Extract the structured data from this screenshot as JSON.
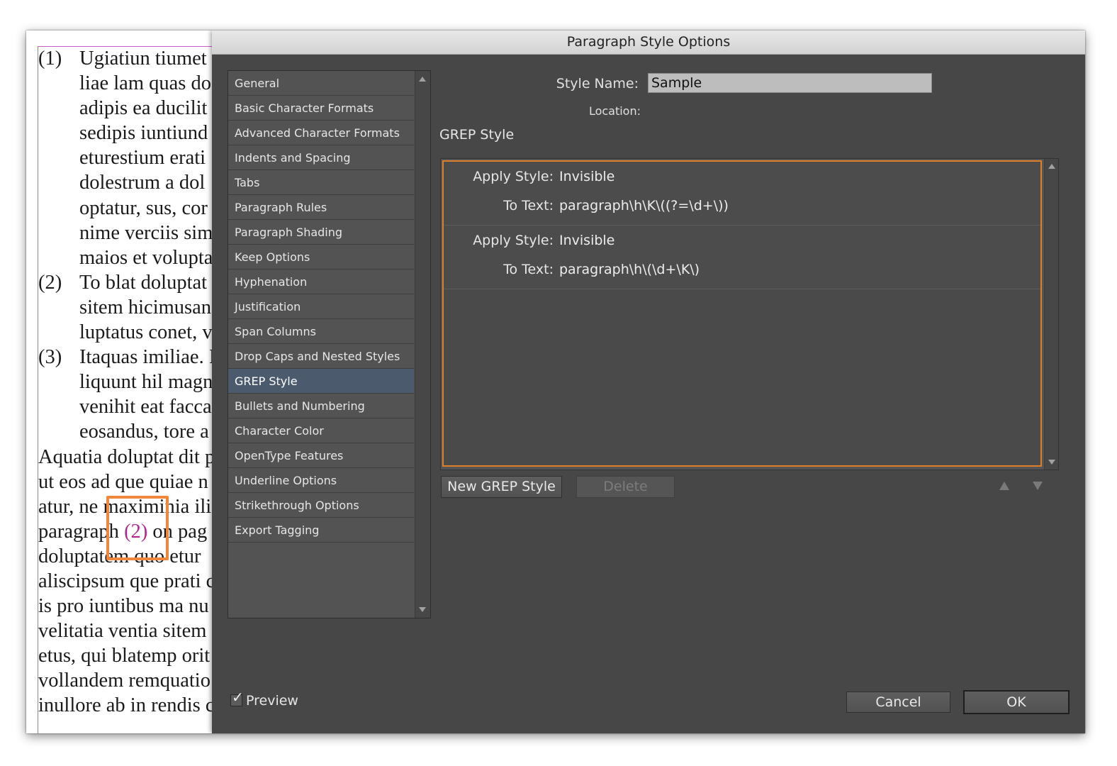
{
  "document": {
    "lines": [
      {
        "num": "(1)",
        "text": "Ugiatiun tiumet"
      },
      {
        "num": "",
        "text": "liae lam quas do"
      },
      {
        "num": "",
        "text": "adipis ea ducilit"
      },
      {
        "num": "",
        "text": "sedipis iuntiund"
      },
      {
        "num": "",
        "text": "eturestium erati"
      },
      {
        "num": "",
        "text": "dolestrum a dol"
      },
      {
        "num": "",
        "text": "optatur, sus, cor"
      },
      {
        "num": "",
        "text": "nime verciis sim"
      },
      {
        "num": "",
        "text": "maios et volupta"
      },
      {
        "num": "(2)",
        "text": "To blat doluptat"
      },
      {
        "num": "",
        "text": "sitem hicimusan"
      },
      {
        "num": "",
        "text": "luptatus conet, v"
      },
      {
        "num": "(3)",
        "text": "Itaquas imiliae. I"
      },
      {
        "num": "",
        "text": "liquunt hil magn"
      },
      {
        "num": "",
        "text": "venihit eat facca"
      },
      {
        "num": "",
        "text": "eosandus, tore a"
      }
    ],
    "body_lines": [
      "Aquatia doluptat dit p",
      "ut eos ad que quiae n",
      "atur, ne maximinia ili",
      "doluptatem quo etur",
      "aliscipsum que prati c",
      "is pro iuntibus ma nu",
      "velitatia ventia sitem",
      "etus, qui blatemp orit",
      "vollandem remquatio",
      "inullore ab in rendis c"
    ],
    "ref_line": {
      "before": "paragraph ",
      "ref": "(2)",
      "after": " on pag"
    }
  },
  "dialog": {
    "title": "Paragraph Style Options",
    "categories": [
      "General",
      "Basic Character Formats",
      "Advanced Character Formats",
      "Indents and Spacing",
      "Tabs",
      "Paragraph Rules",
      "Paragraph Shading",
      "Keep Options",
      "Hyphenation",
      "Justification",
      "Span Columns",
      "Drop Caps and Nested Styles",
      "GREP Style",
      "Bullets and Numbering",
      "Character Color",
      "OpenType Features",
      "Underline Options",
      "Strikethrough Options",
      "Export Tagging"
    ],
    "selected_category": "GREP Style",
    "style_name_label": "Style Name:",
    "style_name_value": "Sample",
    "location_label": "Location:",
    "section_title": "GREP Style",
    "grep_rules": [
      {
        "apply_label": "Apply Style:",
        "apply_value": "Invisible",
        "text_label": "To Text:",
        "text_value": "paragraph\\h\\K\\((?=\\d+\\))"
      },
      {
        "apply_label": "Apply Style:",
        "apply_value": "Invisible",
        "text_label": "To Text:",
        "text_value": "paragraph\\h\\(\\d+\\K\\)"
      }
    ],
    "new_grep_label": "New GREP Style",
    "delete_label": "Delete",
    "preview_label": "Preview",
    "preview_checked": true,
    "cancel_label": "Cancel",
    "ok_label": "OK"
  },
  "colors": {
    "dialog_bg": "#474747",
    "selected_item": "#4b5a6d",
    "grep_border": "#e07f2a",
    "highlight_box": "#f0873c",
    "reference_text": "#b0288c",
    "margin_guide": "#c85fc8"
  }
}
